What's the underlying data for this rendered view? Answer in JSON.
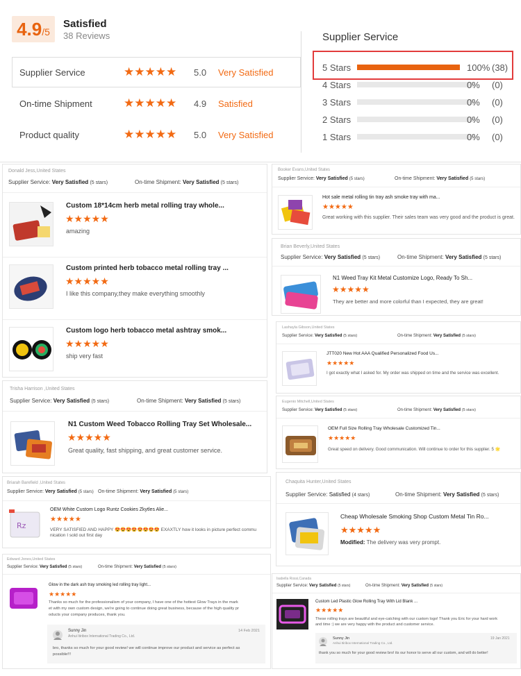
{
  "summary": {
    "score": "4.9",
    "score_of": "/5",
    "title": "Satisfied",
    "review_count": "38 Reviews",
    "metrics": [
      {
        "name": "Supplier Service",
        "stars": "★★★★★",
        "score": "5.0",
        "verbal": "Very Satisfied"
      },
      {
        "name": "On-time Shipment",
        "stars": "★★★★★",
        "score": "4.9",
        "verbal": "Satisfied"
      },
      {
        "name": "Product quality",
        "stars": "★★★★★",
        "score": "5.0",
        "verbal": "Very Satisfied"
      }
    ]
  },
  "distribution": {
    "title": "Supplier Service",
    "rows": [
      {
        "label": "5 Stars",
        "fill": 1.0,
        "pct": "100%",
        "count": "(38)"
      },
      {
        "label": "4 Stars",
        "fill": 0,
        "pct": "0%",
        "count": "(0)"
      },
      {
        "label": "3 Stars",
        "fill": 0,
        "pct": "0%",
        "count": "(0)"
      },
      {
        "label": "2 Stars",
        "fill": 0,
        "pct": "0%",
        "count": "(0)"
      },
      {
        "label": "1 Stars",
        "fill": 0,
        "pct": "0%",
        "count": "(0)"
      }
    ]
  },
  "colors": {
    "accent": "#f26a13",
    "highlight_border": "#e23b3b"
  },
  "labels": {
    "supplier_service": "Supplier Service:",
    "ontime_shipment": "On-time Shipment:"
  },
  "reviews": {
    "r1": {
      "author": "Donald Jess,United States",
      "service": "Very Satisfied",
      "service_stars": "(5 stars)",
      "shipment": "Very Satisfied",
      "shipment_stars": "(5 stars)",
      "items": [
        {
          "title": "Custom 18*14cm herb metal rolling tray whole...",
          "stars": "★★★★★",
          "text": "amazing"
        },
        {
          "title": "Custom printed herb tobacco metal rolling tray ...",
          "stars": "★★★★★",
          "text": "I like this company,they make everything smoothly"
        },
        {
          "title": "Custom logo herb tobacco metal ashtray smok...",
          "stars": "★★★★★",
          "text": "ship very fast"
        }
      ]
    },
    "r2": {
      "author": "Trisha Harrison ,United States",
      "service": "Very Satisfied",
      "service_stars": "(5 stars)",
      "shipment": "Very Satisfied",
      "shipment_stars": "(5 stars)",
      "title": "N1 Custom Weed Tobacco Rolling Tray Set Wholesale...",
      "stars": "★★★★★",
      "text": "Great quality, fast shipping, and great customer service."
    },
    "r3": {
      "author": "Briarah Barefield ,United States",
      "service": "Very Satisfied",
      "service_stars": "(5 stars)",
      "shipment": "Very Satisfied",
      "shipment_stars": "(5 stars)",
      "title": "OEM White Custom Logo Runtz Cookies Zkytles Alie...",
      "stars": "★★★★★",
      "text1": "VERY SATISFIED AND HAPPY 😍😍😍😍😍😍😍😍 EXAXTLY how it looks in picture perfect commu",
      "text2": "nication I sold out first day"
    },
    "r4": {
      "author": "Edward Jones,United States",
      "service": "Very Satisfied",
      "service_stars": "(5 stars)",
      "shipment": "Very Satisfied",
      "shipment_stars": "(5 stars)",
      "title": "Glow in the dark ash tray smoking led rolling tray light...",
      "stars": "★★★★★",
      "text1": "Thanks so much for the professionalism of your company, I have one of the hottest Glow Trays in the mark",
      "text2": "et with my own custom design, we're going to continue doing great business, because of the high quality pr",
      "text3": "oducts your company produces, thank you.",
      "reply_name": "Sunny Jin",
      "reply_company": "Anhui Itiribox International Trading Co., Ltd.",
      "reply_date": "14 Feb 2021",
      "reply_text1": "bro, thanks so much for your good review!  we will continue improve our product and service as perfect as",
      "reply_text2": "possible!!!"
    },
    "r5": {
      "author": "Booker Evans,United States",
      "service": "Very Satisfied",
      "service_stars": "(5 stars)",
      "shipment": "Very Satisfied",
      "shipment_stars": "(5 stars)",
      "title": "Hot sale metal rolling tin tray ash smoke tray with ma...",
      "stars": "★★★★★",
      "text": "Great working with this supplier. Their sales team was very good and the product is great."
    },
    "r6": {
      "author": "Brian Beverly,United States",
      "service": "Very Satisfied",
      "service_stars": "(5 stars)",
      "shipment": "Very Satisfied",
      "shipment_stars": "(5 stars)",
      "title": "N1 Weed Tray Kit Metal Customize Logo, Ready To Sh...",
      "stars": "★★★★★",
      "text": "They are better and more colorful than I expected, they are great!"
    },
    "r7": {
      "author": "Lashayla Gibson,United States",
      "service": "Very Satisfied",
      "service_stars": "(5 stars)",
      "shipment": "Very Satisfied",
      "shipment_stars": "(5 stars)",
      "title": "JTT020 New Hot AAA Qualified Personalized Food Us...",
      "stars": "★★★★★",
      "text": "I got exactly what I asked for. My order was shipped on time and the service was excellent."
    },
    "r8": {
      "author": "Eugenio Mitchell,United States",
      "service": "Very Satisfied",
      "service_stars": "(5 stars)",
      "shipment": "Very Satisfied",
      "shipment_stars": "(5 stars)",
      "title": "OEM Full Size Rolling Tray Wholesale Customized Tin...",
      "stars": "★★★★★",
      "text": "Great speed on delivery. Good communication. Will continue to order for this supplier. 5 🌟"
    },
    "r9": {
      "author": "Chaquita Hunter,United States",
      "service": "Satisfied",
      "service_stars": "(4 stars)",
      "shipment": "Very Satisfied",
      "shipment_stars": "(5 stars)",
      "title": "Cheap Wholesale Smoking Shop Custom Metal Tin Ro...",
      "stars": "★★★★★",
      "modified_label": "Modified:",
      "text": "The delivery was very prompt."
    },
    "r10": {
      "author": "Isabella Rossi,Canada",
      "service": "Very Satisfied",
      "service_stars": "(5 stars)",
      "shipment": "Very Satisfied",
      "shipment_stars": "(5 stars)",
      "title": "Custom Led Plastic Glow Rolling Tray With Lid Blank ...",
      "stars": "★★★★★",
      "text1": "These rolling trays are beautiful and eye-catching with our custom logo! Thank you Eric for your hard work",
      "text2": "and time :) we are very happy with the product and customer service.",
      "reply_name": "Sunny Jin",
      "reply_company": "Anhui Itiribox International Trading Co., Ltd.",
      "reply_date": "19 Jan 2021",
      "reply_text": "thank you so much for your good review bro!  its our honor to serve all our custom, and will do better!"
    }
  }
}
